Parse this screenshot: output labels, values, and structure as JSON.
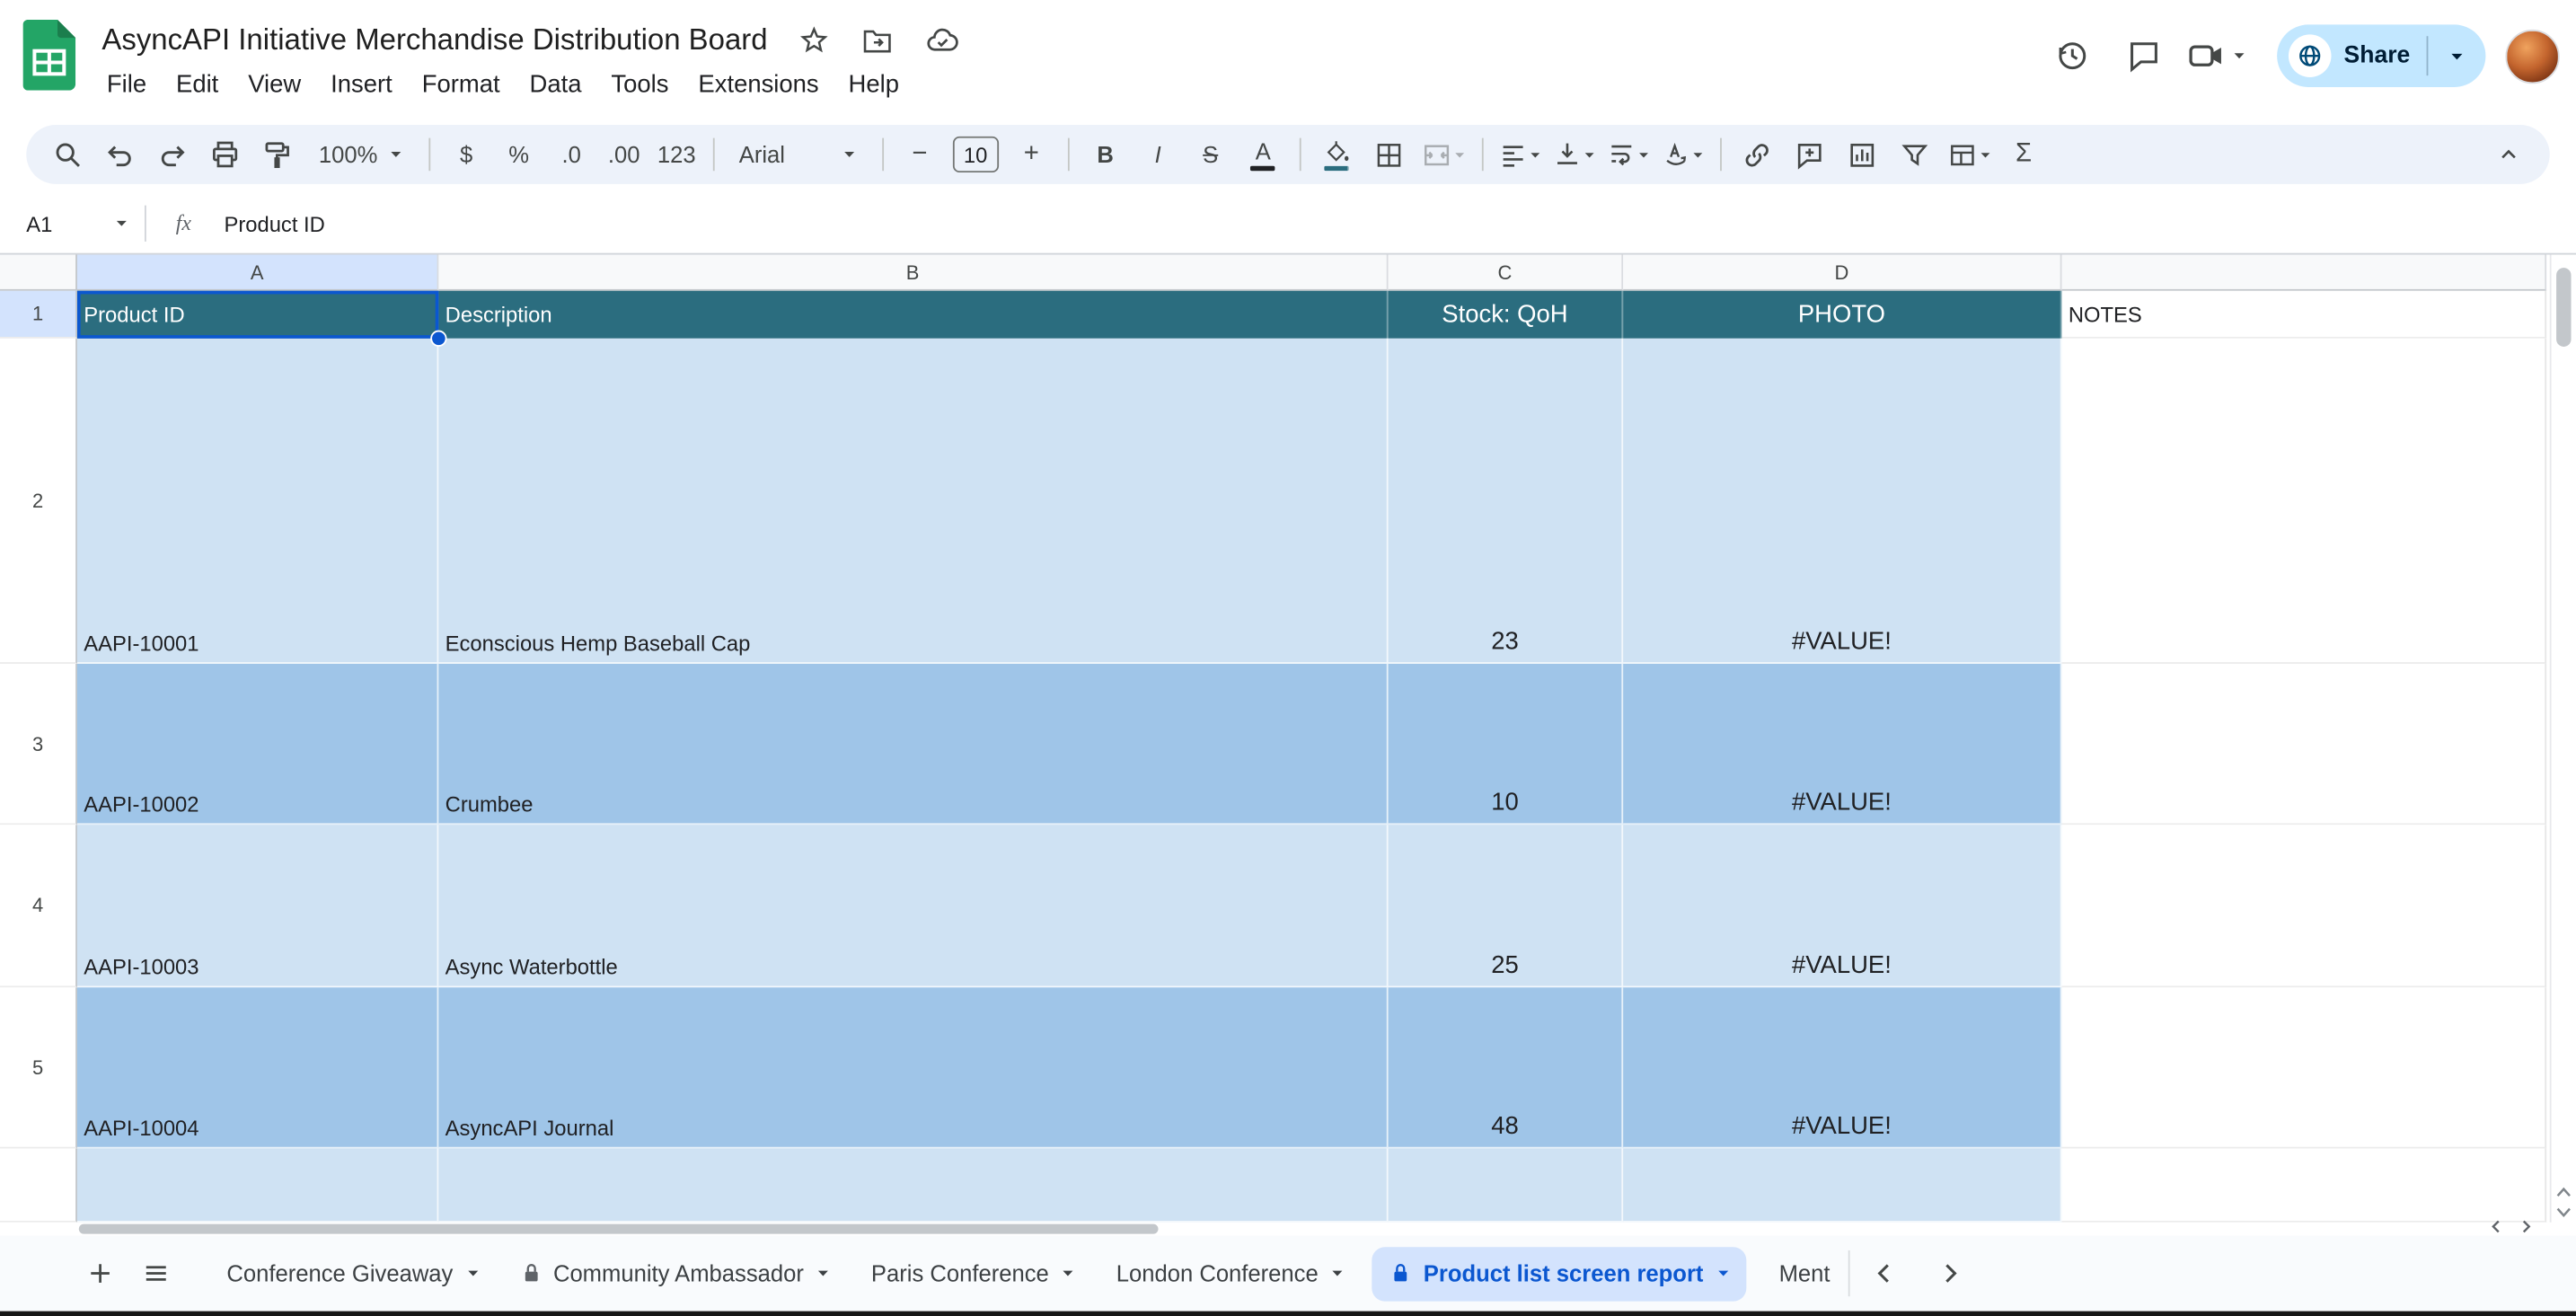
{
  "titlebar": {
    "title": "AsyncAPI Initiative Merchandise Distribution Board",
    "menus": [
      "File",
      "Edit",
      "View",
      "Insert",
      "Format",
      "Data",
      "Tools",
      "Extensions",
      "Help"
    ],
    "share_label": "Share"
  },
  "toolbar": {
    "zoom": "100%",
    "currency": "$",
    "percent": "%",
    "decrease_decimal": ".0",
    "increase_decimal": ".00",
    "plain_format": "123",
    "font_name": "Arial",
    "minus": "−",
    "font_size": "10",
    "plus": "+",
    "bold": "B",
    "italic": "I",
    "strikethrough": "S",
    "text_color": "A",
    "functions": "Σ"
  },
  "formula_bar": {
    "cell_ref": "A1",
    "fx_label": "fx",
    "value": "Product ID"
  },
  "grid": {
    "col_letters": [
      "A",
      "B",
      "C",
      "D"
    ],
    "row_numbers": [
      "1",
      "2",
      "3",
      "4",
      "5"
    ],
    "header_row": {
      "product_id": "Product ID",
      "description": "Description",
      "stock": "Stock: QoH",
      "photo": "PHOTO",
      "notes": "NOTES"
    },
    "rows": [
      {
        "product_id": "AAPI-10001",
        "description": "Econscious Hemp Baseball Cap",
        "stock": "23",
        "photo": "#VALUE!"
      },
      {
        "product_id": "AAPI-10002",
        "description": "Crumbee",
        "stock": "10",
        "photo": "#VALUE!"
      },
      {
        "product_id": "AAPI-10003",
        "description": "Async Waterbottle",
        "stock": "25",
        "photo": "#VALUE!"
      },
      {
        "product_id": "AAPI-10004",
        "description": "AsyncAPI Journal",
        "stock": "48",
        "photo": "#VALUE!"
      }
    ]
  },
  "sheet_tabs": {
    "items": [
      {
        "label": "Conference Giveaway",
        "locked": false,
        "active": false
      },
      {
        "label": "Community Ambassador",
        "locked": true,
        "active": false
      },
      {
        "label": "Paris Conference",
        "locked": false,
        "active": false
      },
      {
        "label": "London Conference",
        "locked": false,
        "active": false
      },
      {
        "label": "Product list screen report",
        "locked": true,
        "active": true
      },
      {
        "label": "Ment",
        "locked": false,
        "active": false,
        "truncated": true
      }
    ]
  },
  "colors": {
    "teal_header": "#2b6d7f",
    "band_light": "#cfe2f3",
    "band_dark": "#9fc5e8",
    "selection_blue": "#0b57d0",
    "selected_header_bg": "#d3e3fd",
    "share_bg": "#c2e7ff",
    "toolbar_bg": "#edf2fa",
    "active_tab_bg": "#d3e3fd",
    "active_tab_text": "#0b57d0",
    "logo_green": "#23a566"
  }
}
